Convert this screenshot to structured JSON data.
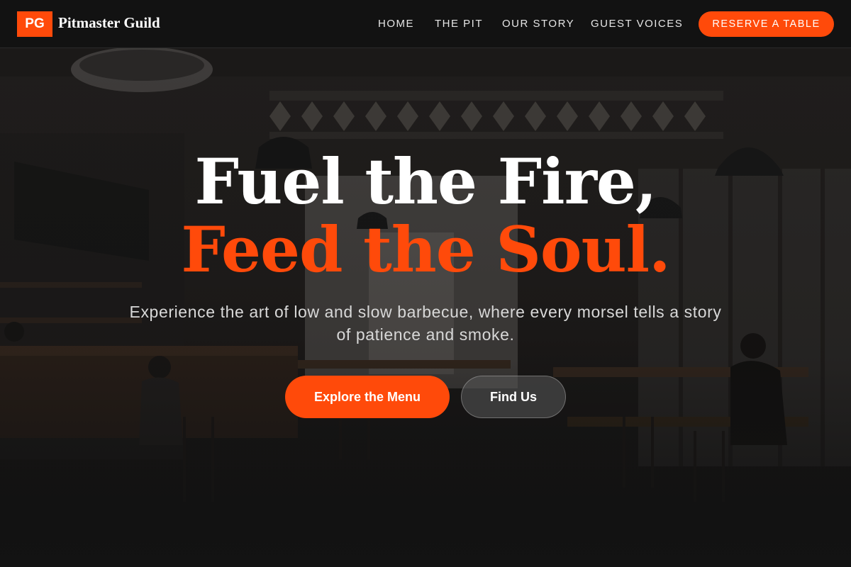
{
  "brand": {
    "badge": "PG",
    "name": "Pitmaster Guild",
    "accent": "#ff4a0a"
  },
  "nav": {
    "links": [
      "HOME",
      "THE PIT",
      "OUR STORY",
      "GUEST VOICES"
    ],
    "cta": "RESERVE A TABLE"
  },
  "hero": {
    "headline_line1": "Fuel the Fire,",
    "headline_line2": "Feed the Soul.",
    "subtitle": "Experience the art of low and slow barbecue, where every morsel tells a story of patience and smoke.",
    "primary_button": "Explore the Menu",
    "secondary_button": "Find Us"
  }
}
